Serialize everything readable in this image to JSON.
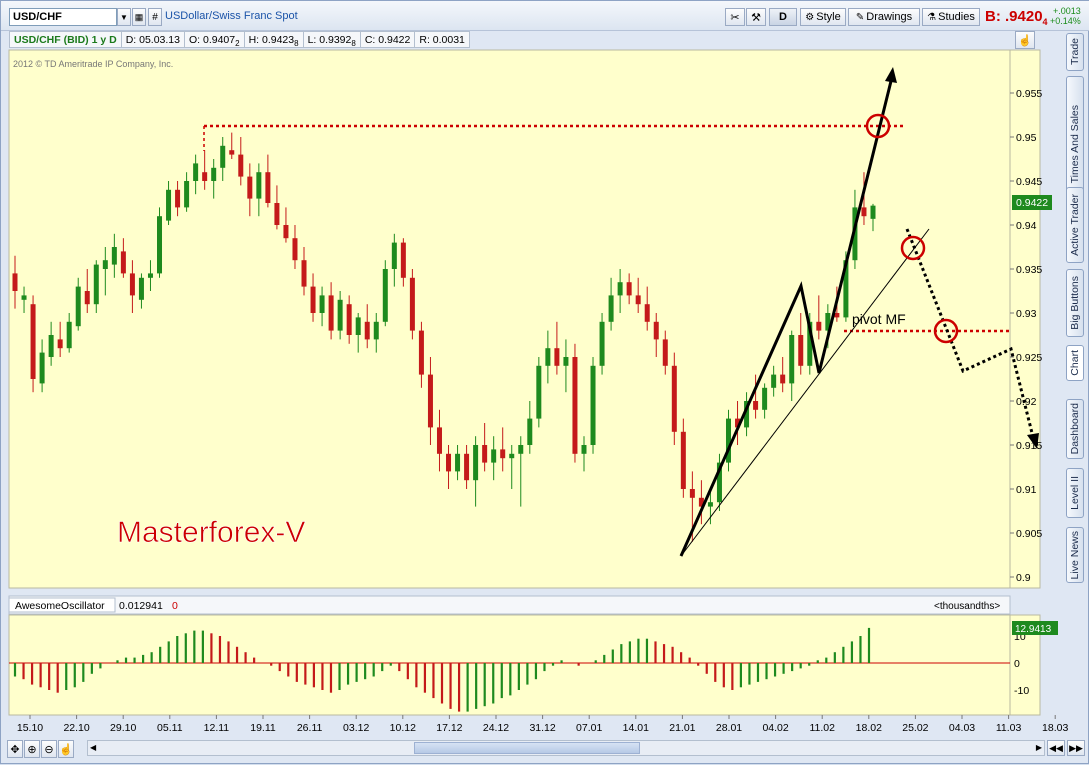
{
  "toolbar": {
    "symbol": "USD/CHF",
    "description": "USDollar/Swiss Franc Spot",
    "d_label": "D",
    "style_label": "Style",
    "drawings_label": "Drawings",
    "studies_label": "Studies",
    "bid_prefix": "B:",
    "bid_value": ".9420",
    "bid_sup": "4",
    "change_abs": "+.0013",
    "change_pct": "+0.14%"
  },
  "infobar": {
    "title": "USD/CHF (BID) 1 y D",
    "date": "D: 05.03.13",
    "open": "O: 0.9407",
    "open_sup": "2",
    "high": "H: 0.9423",
    "high_sup": "8",
    "low": "L: 0.9392",
    "low_sup": "8",
    "close": "C: 0.9422",
    "range": "R: 0.0031"
  },
  "copyright": "2012 © TD Ameritrade IP Company, Inc.",
  "watermark": "Masterforex-V",
  "annotation_pivot": "pivot MF",
  "price_axis": {
    "ticks": [
      "0.955",
      "0.95",
      "0.945",
      "0.94",
      "0.935",
      "0.93",
      "0.925",
      "0.92",
      "0.915",
      "0.91",
      "0.905",
      "0.9"
    ],
    "last_price": "0.9422"
  },
  "oscillator": {
    "name": "AwesomeOscillator",
    "value": "0.012941",
    "value2": "0",
    "units": "<thousandths>",
    "ticks": [
      "10",
      "0",
      "-10"
    ],
    "last_value": "12.9413"
  },
  "time_axis": [
    "15.10",
    "22.10",
    "29.10",
    "05.11",
    "12.11",
    "19.11",
    "26.11",
    "03.12",
    "10.12",
    "17.12",
    "24.12",
    "31.12",
    "07.01",
    "14.01",
    "21.01",
    "28.01",
    "04.02",
    "11.02",
    "18.02",
    "25.02",
    "04.03",
    "11.03",
    "18.03"
  ],
  "side_tabs": [
    "Trade",
    "Times And Sales",
    "Active Trader",
    "Big Buttons",
    "Chart",
    "Dashboard",
    "Level II",
    "Live News"
  ],
  "colors": {
    "up": "#1e8a1e",
    "down": "#c41a1a",
    "chart_bg": "#ffffcc",
    "accent": "#cc0000"
  },
  "chart_data": {
    "type": "candlestick",
    "series": [
      {
        "name": "USD/CHF (BID)",
        "values": [
          [
            0.9345,
            0.9365,
            0.9305,
            0.9325
          ],
          [
            0.9315,
            0.933,
            0.93,
            0.932
          ],
          [
            0.931,
            0.932,
            0.921,
            0.9225
          ],
          [
            0.922,
            0.927,
            0.921,
            0.9255
          ],
          [
            0.925,
            0.929,
            0.924,
            0.9275
          ],
          [
            0.927,
            0.929,
            0.925,
            0.926
          ],
          [
            0.926,
            0.93,
            0.9255,
            0.929
          ],
          [
            0.9285,
            0.934,
            0.928,
            0.933
          ],
          [
            0.9325,
            0.935,
            0.93,
            0.931
          ],
          [
            0.931,
            0.936,
            0.93,
            0.9355
          ],
          [
            0.935,
            0.9375,
            0.932,
            0.936
          ],
          [
            0.9355,
            0.939,
            0.934,
            0.9375
          ],
          [
            0.937,
            0.9385,
            0.934,
            0.9345
          ],
          [
            0.9345,
            0.936,
            0.93,
            0.932
          ],
          [
            0.9315,
            0.9345,
            0.9305,
            0.934
          ],
          [
            0.934,
            0.936,
            0.9325,
            0.9345
          ],
          [
            0.9345,
            0.942,
            0.934,
            0.941
          ],
          [
            0.9405,
            0.945,
            0.94,
            0.944
          ],
          [
            0.944,
            0.945,
            0.941,
            0.942
          ],
          [
            0.942,
            0.946,
            0.9415,
            0.945
          ],
          [
            0.945,
            0.948,
            0.9435,
            0.947
          ],
          [
            0.946,
            0.9485,
            0.944,
            0.945
          ],
          [
            0.945,
            0.9475,
            0.943,
            0.9465
          ],
          [
            0.9465,
            0.95,
            0.945,
            0.949
          ],
          [
            0.9485,
            0.9505,
            0.9475,
            0.948
          ],
          [
            0.948,
            0.95,
            0.9445,
            0.9455
          ],
          [
            0.9455,
            0.947,
            0.941,
            0.943
          ],
          [
            0.943,
            0.947,
            0.941,
            0.946
          ],
          [
            0.946,
            0.948,
            0.942,
            0.9425
          ],
          [
            0.9425,
            0.9445,
            0.9395,
            0.94
          ],
          [
            0.94,
            0.942,
            0.938,
            0.9385
          ],
          [
            0.9385,
            0.94,
            0.935,
            0.936
          ],
          [
            0.936,
            0.9375,
            0.932,
            0.933
          ],
          [
            0.933,
            0.9345,
            0.929,
            0.93
          ],
          [
            0.93,
            0.933,
            0.9285,
            0.932
          ],
          [
            0.932,
            0.9335,
            0.927,
            0.928
          ],
          [
            0.928,
            0.9325,
            0.927,
            0.9315
          ],
          [
            0.931,
            0.932,
            0.9265,
            0.9275
          ],
          [
            0.9275,
            0.93,
            0.9255,
            0.9295
          ],
          [
            0.929,
            0.931,
            0.926,
            0.927
          ],
          [
            0.927,
            0.93,
            0.9255,
            0.929
          ],
          [
            0.929,
            0.936,
            0.9285,
            0.935
          ],
          [
            0.935,
            0.939,
            0.933,
            0.938
          ],
          [
            0.938,
            0.9385,
            0.933,
            0.934
          ],
          [
            0.934,
            0.935,
            0.927,
            0.928
          ],
          [
            0.928,
            0.929,
            0.9215,
            0.923
          ],
          [
            0.923,
            0.925,
            0.915,
            0.917
          ],
          [
            0.917,
            0.919,
            0.912,
            0.914
          ],
          [
            0.914,
            0.915,
            0.91,
            0.912
          ],
          [
            0.912,
            0.915,
            0.911,
            0.914
          ],
          [
            0.914,
            0.915,
            0.91,
            0.911
          ],
          [
            0.911,
            0.916,
            0.908,
            0.915
          ],
          [
            0.915,
            0.9175,
            0.912,
            0.913
          ],
          [
            0.913,
            0.916,
            0.911,
            0.9145
          ],
          [
            0.9145,
            0.917,
            0.912,
            0.9135
          ],
          [
            0.9135,
            0.915,
            0.91,
            0.914
          ],
          [
            0.914,
            0.916,
            0.908,
            0.915
          ],
          [
            0.915,
            0.92,
            0.914,
            0.918
          ],
          [
            0.918,
            0.925,
            0.917,
            0.924
          ],
          [
            0.924,
            0.928,
            0.922,
            0.926
          ],
          [
            0.926,
            0.929,
            0.923,
            0.924
          ],
          [
            0.924,
            0.927,
            0.921,
            0.925
          ],
          [
            0.925,
            0.9265,
            0.913,
            0.914
          ],
          [
            0.914,
            0.916,
            0.912,
            0.915
          ],
          [
            0.915,
            0.925,
            0.914,
            0.924
          ],
          [
            0.924,
            0.93,
            0.923,
            0.929
          ],
          [
            0.929,
            0.934,
            0.928,
            0.932
          ],
          [
            0.932,
            0.935,
            0.93,
            0.9335
          ],
          [
            0.9335,
            0.9345,
            0.931,
            0.932
          ],
          [
            0.932,
            0.934,
            0.93,
            0.931
          ],
          [
            0.931,
            0.933,
            0.928,
            0.929
          ],
          [
            0.929,
            0.93,
            0.925,
            0.927
          ],
          [
            0.927,
            0.928,
            0.923,
            0.924
          ],
          [
            0.924,
            0.9255,
            0.915,
            0.9165
          ],
          [
            0.9165,
            0.918,
            0.909,
            0.91
          ],
          [
            0.91,
            0.912,
            0.904,
            0.909
          ],
          [
            0.909,
            0.911,
            0.906,
            0.908
          ],
          [
            0.908,
            0.91,
            0.906,
            0.9085
          ],
          [
            0.9085,
            0.914,
            0.9075,
            0.913
          ],
          [
            0.913,
            0.919,
            0.912,
            0.918
          ],
          [
            0.918,
            0.92,
            0.915,
            0.917
          ],
          [
            0.917,
            0.921,
            0.916,
            0.92
          ],
          [
            0.92,
            0.923,
            0.918,
            0.919
          ],
          [
            0.919,
            0.922,
            0.918,
            0.9215
          ],
          [
            0.9215,
            0.924,
            0.9205,
            0.923
          ],
          [
            0.923,
            0.925,
            0.921,
            0.922
          ],
          [
            0.922,
            0.928,
            0.92,
            0.9275
          ],
          [
            0.9275,
            0.93,
            0.923,
            0.924
          ],
          [
            0.924,
            0.93,
            0.923,
            0.929
          ],
          [
            0.929,
            0.932,
            0.927,
            0.928
          ],
          [
            0.928,
            0.931,
            0.926,
            0.93
          ],
          [
            0.93,
            0.933,
            0.929,
            0.9295
          ],
          [
            0.9295,
            0.937,
            0.929,
            0.936
          ],
          [
            0.936,
            0.944,
            0.935,
            0.942
          ],
          [
            0.942,
            0.946,
            0.94,
            0.941
          ],
          [
            0.9407,
            0.9424,
            0.9393,
            0.9422
          ]
        ]
      }
    ],
    "oscillator_values": [
      -5,
      -6,
      -8,
      -9,
      -10,
      -11,
      -10,
      -9,
      -7,
      -4,
      -2,
      0,
      1,
      2,
      2,
      3,
      4,
      6,
      8,
      10,
      11,
      12,
      12,
      11,
      10,
      8,
      6,
      4,
      2,
      0,
      -1,
      -3,
      -5,
      -7,
      -8,
      -9,
      -10,
      -11,
      -10,
      -8,
      -7,
      -6,
      -5,
      -3,
      -1,
      -3,
      -6,
      -9,
      -11,
      -13,
      -15,
      -17,
      -18,
      -18,
      -17,
      -16,
      -15,
      -13,
      -12,
      -10,
      -8,
      -6,
      -3,
      -1,
      1,
      0,
      -1,
      0,
      1,
      3,
      5,
      7,
      8,
      9,
      9,
      8,
      7,
      6,
      4,
      2,
      -1,
      -4,
      -7,
      -9,
      -10,
      -9,
      -8,
      -7,
      -6,
      -5,
      -4,
      -3,
      -2,
      -1,
      1,
      2,
      4,
      6,
      8,
      10,
      13
    ]
  }
}
